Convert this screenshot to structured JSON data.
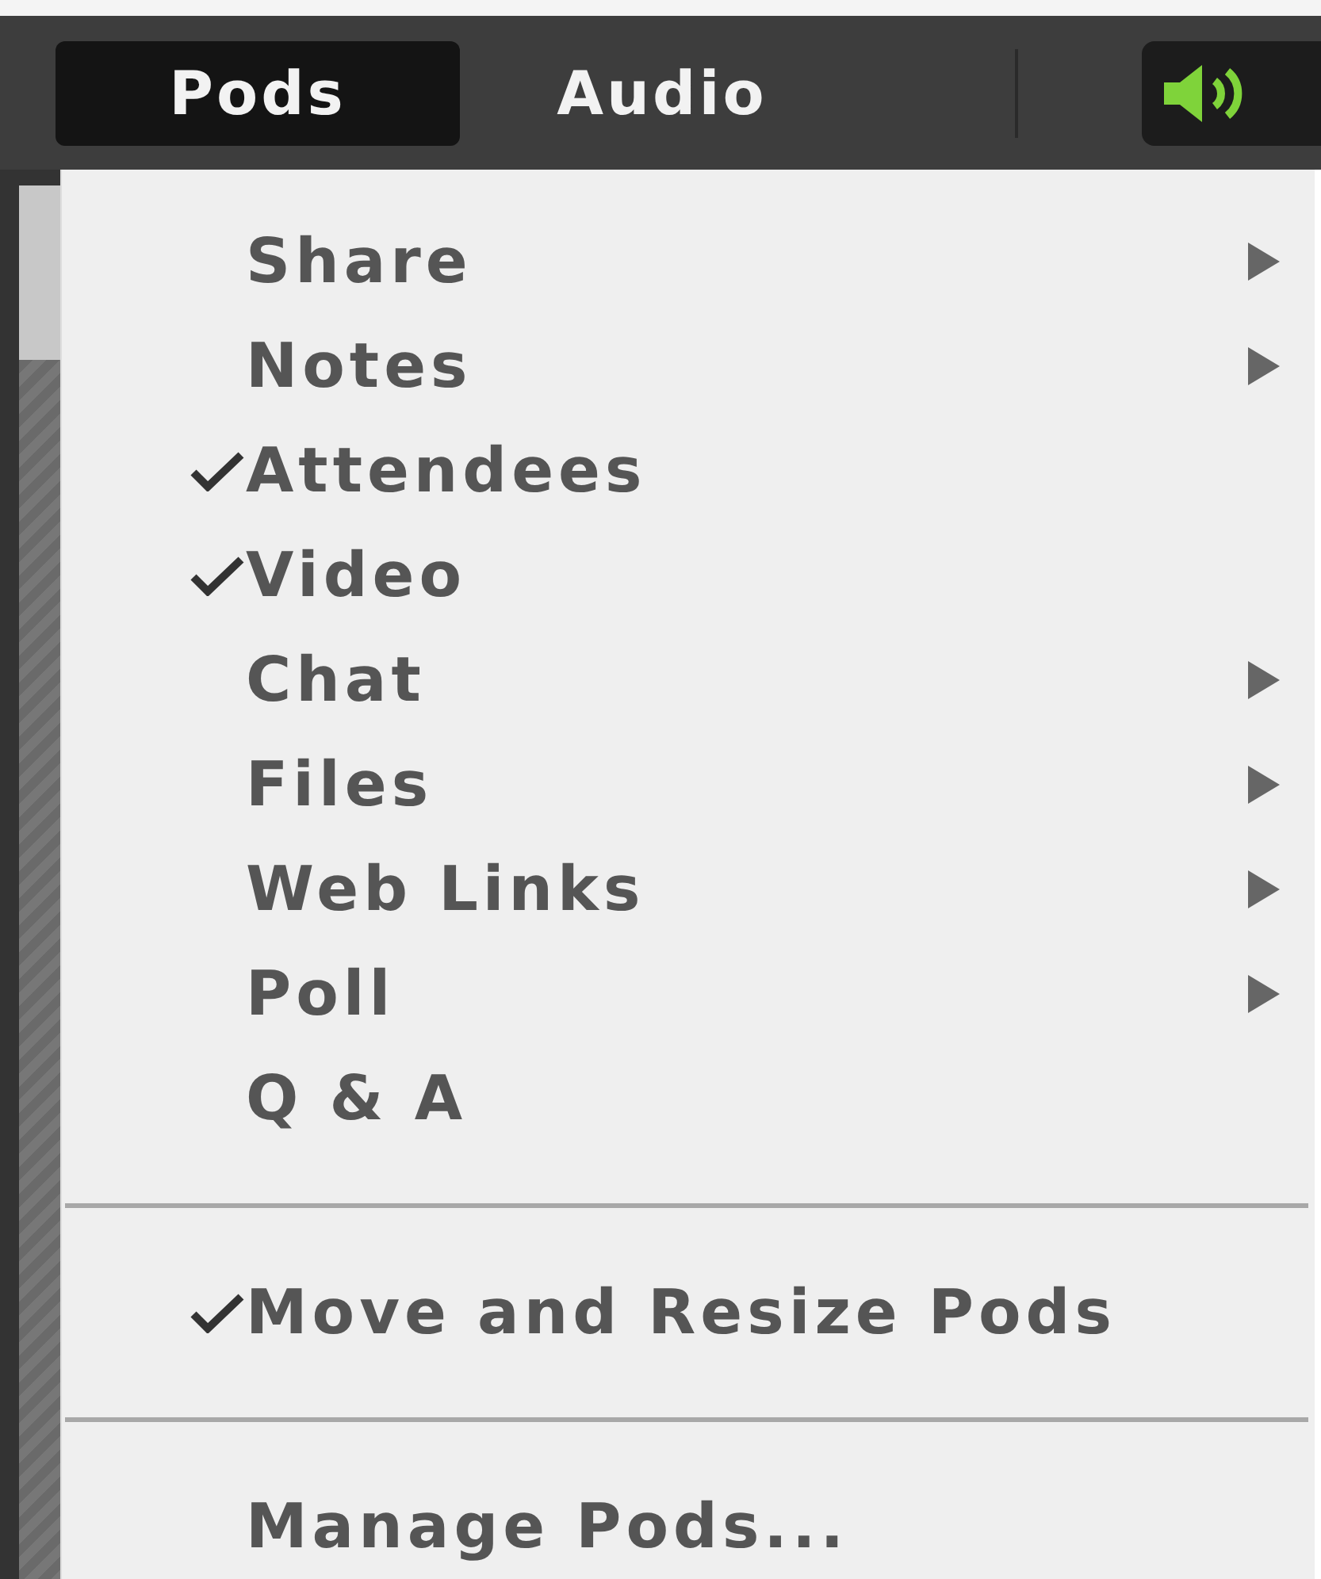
{
  "menubar": {
    "tabs": [
      {
        "label": "Pods",
        "selected": true
      },
      {
        "label": "Audio",
        "selected": false
      }
    ]
  },
  "menu": {
    "sections": [
      [
        {
          "label": "Share",
          "checked": false,
          "submenu": true
        },
        {
          "label": "Notes",
          "checked": false,
          "submenu": true
        },
        {
          "label": "Attendees",
          "checked": true,
          "submenu": false
        },
        {
          "label": "Video",
          "checked": true,
          "submenu": false
        },
        {
          "label": "Chat",
          "checked": false,
          "submenu": true
        },
        {
          "label": "Files",
          "checked": false,
          "submenu": true
        },
        {
          "label": "Web Links",
          "checked": false,
          "submenu": true
        },
        {
          "label": "Poll",
          "checked": false,
          "submenu": true
        },
        {
          "label": "Q & A",
          "checked": false,
          "submenu": false
        }
      ],
      [
        {
          "label": "Move and Resize Pods",
          "checked": true,
          "submenu": false
        }
      ],
      [
        {
          "label": "Manage Pods...",
          "checked": false,
          "submenu": false
        }
      ]
    ]
  }
}
